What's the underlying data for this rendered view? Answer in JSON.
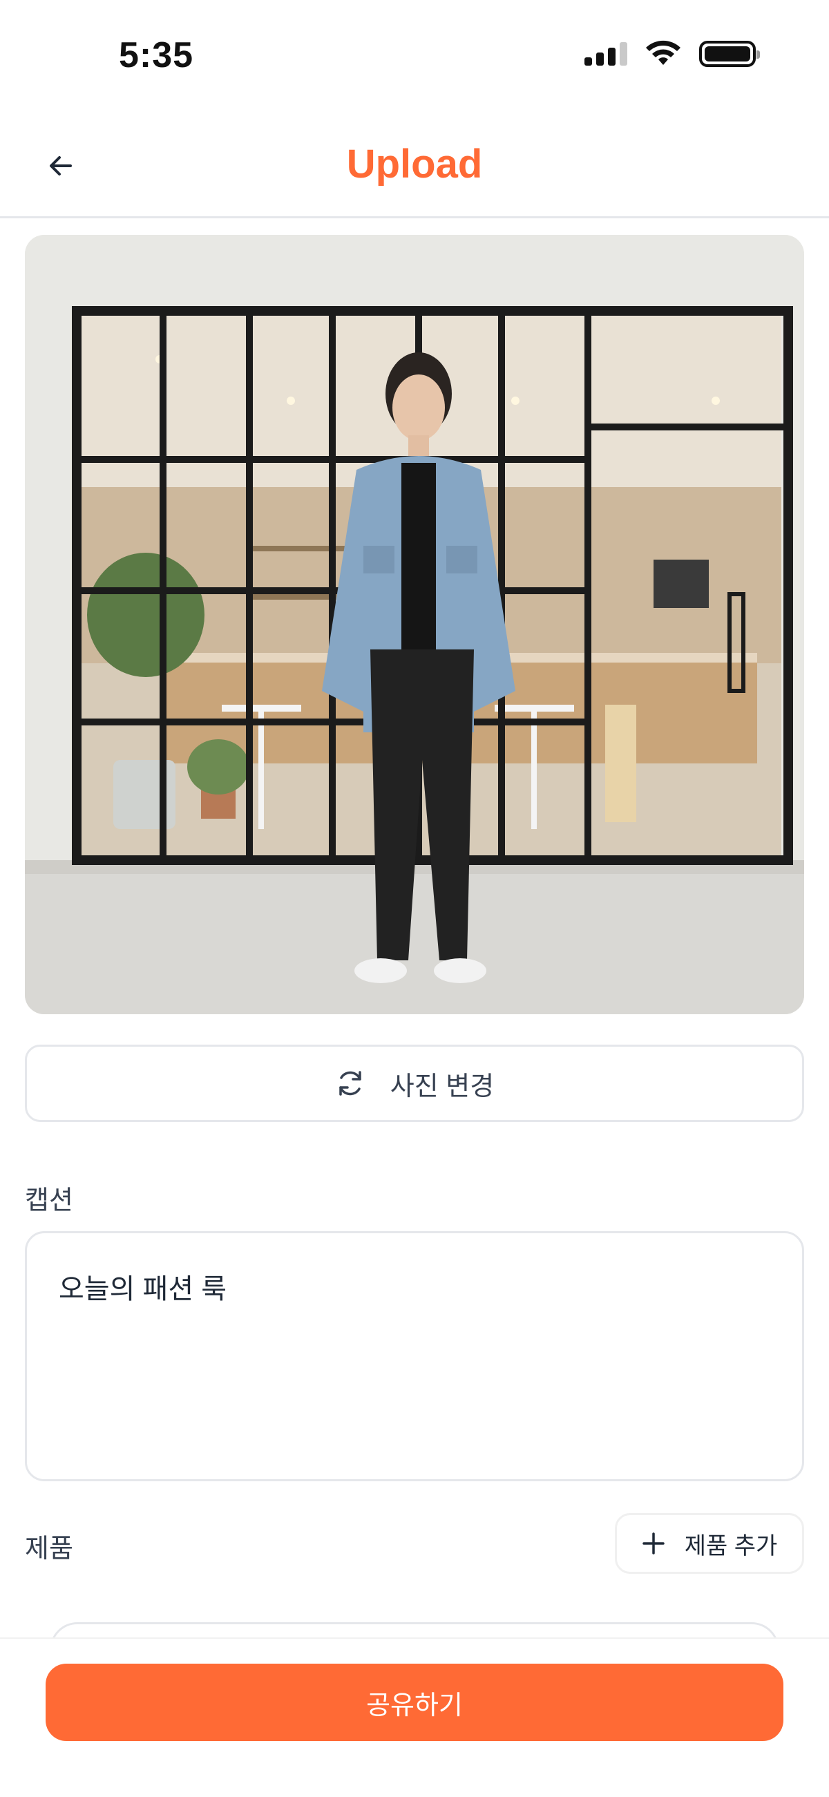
{
  "status_bar": {
    "time": "5:35"
  },
  "header": {
    "title": "Upload"
  },
  "photo": {
    "description_icon": "photo"
  },
  "change_photo": {
    "label": "사진 변경"
  },
  "caption": {
    "label": "캡션",
    "value": "오늘의 패션 룩"
  },
  "products": {
    "label": "제품",
    "add_label": "제품 추가"
  },
  "share": {
    "label": "공유하기"
  },
  "colors": {
    "accent": "#ff6a35",
    "border": "#e5e7eb",
    "text": "#1f2937"
  }
}
